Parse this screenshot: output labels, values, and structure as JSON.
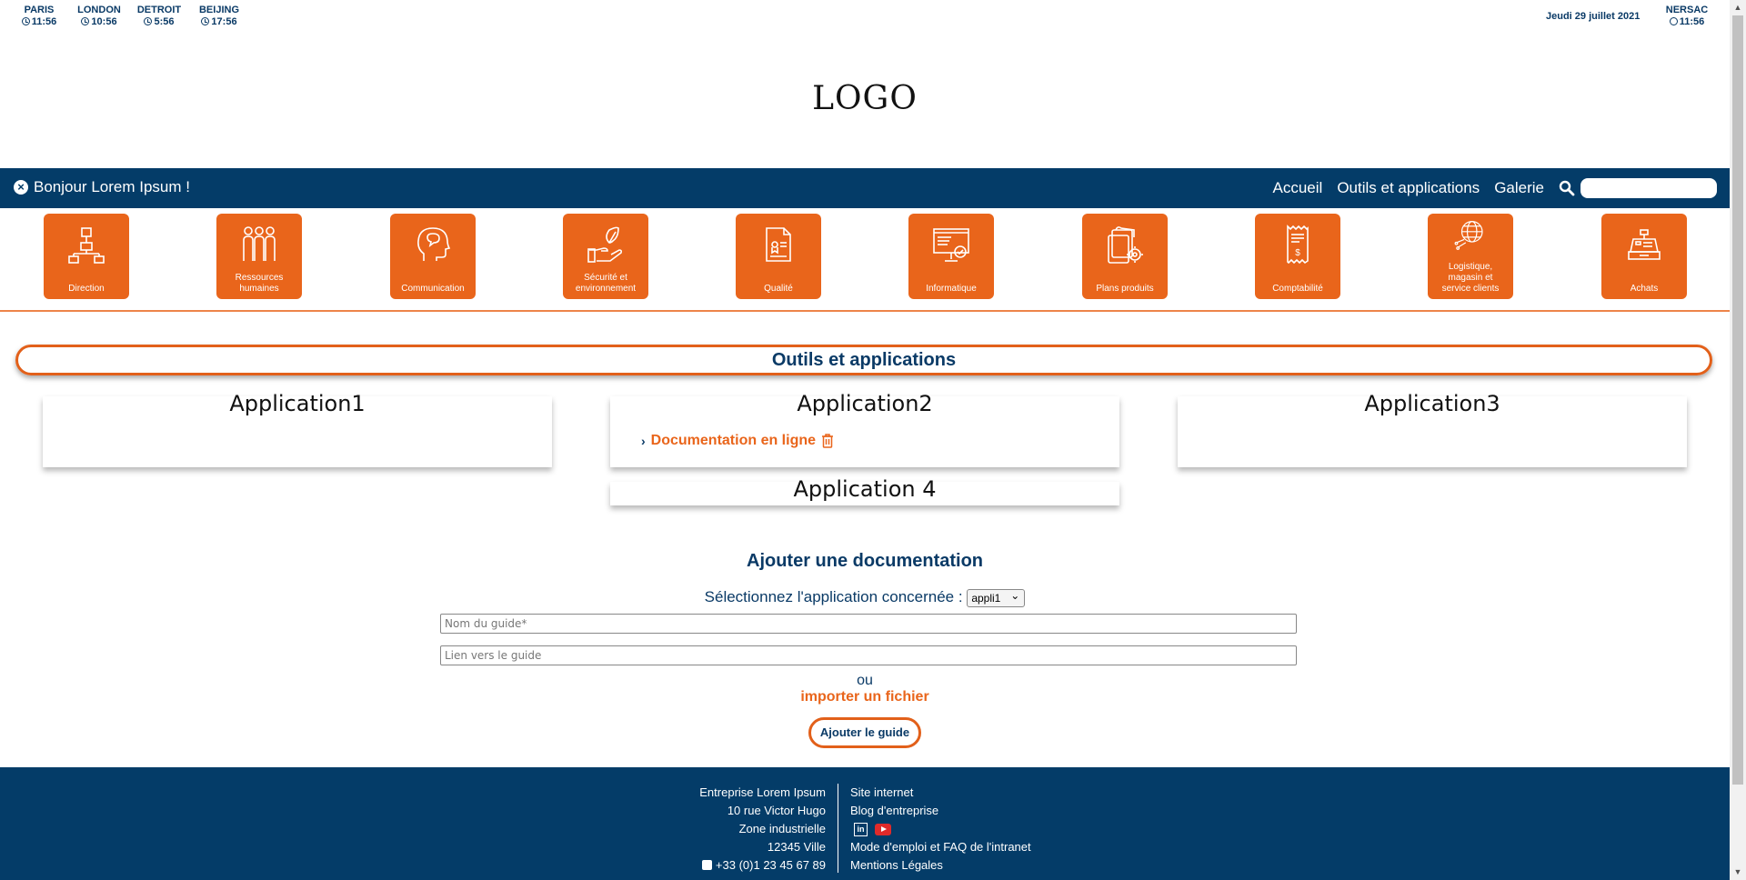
{
  "clocks": [
    {
      "city": "PARIS",
      "time": "11:56"
    },
    {
      "city": "LONDON",
      "time": "10:56"
    },
    {
      "city": "DETROIT",
      "time": "5:56"
    },
    {
      "city": "BEIJING",
      "time": "17:56"
    }
  ],
  "date": "Jeudi 29 juillet 2021",
  "local_clock": {
    "city": "NERSAC",
    "time": "11:56"
  },
  "logo": "LOGO",
  "navbar": {
    "greeting": "Bonjour Lorem Ipsum !",
    "links": [
      "Accueil",
      "Outils et applications",
      "Galerie"
    ],
    "search_placeholder": ""
  },
  "categories": [
    {
      "label": "Direction",
      "icon": "org-chart-icon"
    },
    {
      "label": "Ressources humaines",
      "icon": "people-icon"
    },
    {
      "label": "Communication",
      "icon": "head-speech-icon"
    },
    {
      "label": "Sécurité et environnement",
      "icon": "hand-leaf-icon"
    },
    {
      "label": "Qualité",
      "icon": "quality-document-icon"
    },
    {
      "label": "Informatique",
      "icon": "computer-screen-icon"
    },
    {
      "label": "Plans produits",
      "icon": "plans-gear-icon"
    },
    {
      "label": "Comptabilité",
      "icon": "receipt-icon"
    },
    {
      "label": "Logistique, magasin et service clients",
      "icon": "globe-network-icon"
    },
    {
      "label": "Achats",
      "icon": "cash-register-icon"
    }
  ],
  "section_title": "Outils et applications",
  "applications": {
    "app1": {
      "title": "Application1"
    },
    "app2": {
      "title": "Application2",
      "link": "Documentation en ligne"
    },
    "app3": {
      "title": "Application3"
    },
    "app4": {
      "title": "Application 4"
    }
  },
  "add_doc": {
    "title": "Ajouter une documentation",
    "select_label": "Sélectionnez l'application concernée :",
    "select_value": "appli1",
    "name_placeholder": "Nom du guide*",
    "link_placeholder": "Lien vers le guide",
    "or_text": "ou",
    "import_text": "importer un fichier",
    "submit_label": "Ajouter le guide"
  },
  "footer": {
    "company": "Entreprise Lorem Ipsum",
    "street": "10 rue Victor Hugo",
    "zone": "Zone industrielle",
    "city": "12345 Ville",
    "phone": "+33 (0)1 23 45 67 89",
    "links": {
      "site": "Site internet",
      "blog": "Blog d'entreprise",
      "faq": "Mode d'emploi et FAQ de l'intranet",
      "legal": "Mentions Légales"
    },
    "linkedin_label": "in"
  },
  "colors": {
    "navy": "#043c68",
    "orange": "#e9651b"
  }
}
